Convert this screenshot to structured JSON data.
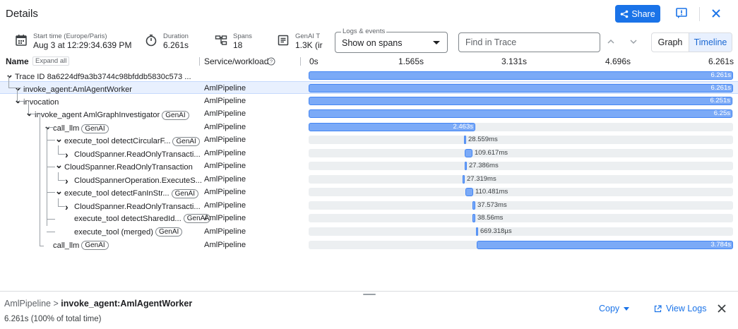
{
  "header": {
    "title": "Details",
    "share_label": "Share"
  },
  "summary": {
    "start_label": "Start time (Europe/Paris)",
    "start_value": "Aug 3 at 12:29:34.639 PM",
    "duration_label": "Duration",
    "duration_value": "6.261s",
    "spans_label": "Spans",
    "spans_value": "18",
    "genai_label": "GenAI T",
    "genai_value": "1.3K (ir",
    "logs_label": "Logs & events",
    "logs_value": "Show on spans",
    "find_placeholder": "Find in Trace",
    "view_graph": "Graph",
    "view_timeline": "Timeline"
  },
  "columns": {
    "name": "Name",
    "expand_all": "Expand all",
    "service": "Service/workload",
    "ticks": [
      "0s",
      "1.565s",
      "3.131s",
      "4.696s",
      "6.261s"
    ]
  },
  "total_duration_s": 6.261,
  "rows": [
    {
      "name": "Trace ID 8a6224df9a3b3744c98bfddb5830c573 ...",
      "chevron": "down",
      "chip": "",
      "service": "",
      "start_s": 0,
      "duration_s": 6.261,
      "label": "6.261s"
    },
    {
      "name": "invoke_agent:AmlAgentWorker",
      "chevron": "down",
      "chip": "",
      "service": "AmlPipeline",
      "start_s": 0,
      "duration_s": 6.261,
      "label": "6.261s"
    },
    {
      "name": "invocation",
      "chevron": "down",
      "chip": "",
      "service": "AmlPipeline",
      "start_s": 0,
      "duration_s": 6.251,
      "label": "6.251s"
    },
    {
      "name": "invoke_agent AmlGraphInvestigator",
      "chevron": "down",
      "chip": "GenAI",
      "service": "AmlPipeline",
      "start_s": 0,
      "duration_s": 6.25,
      "label": "6.25s"
    },
    {
      "name": "call_llm",
      "chevron": "down",
      "chip": "GenAI",
      "service": "AmlPipeline",
      "start_s": 0,
      "duration_s": 2.463,
      "label": "2.463s"
    },
    {
      "name": "execute_tool detectCircularF...",
      "chevron": "down",
      "chip": "GenAI",
      "service": "AmlPipeline",
      "start_s": 2.289,
      "duration_s": 0.028559,
      "label": "28.559ms"
    },
    {
      "name": "CloudSpanner.ReadOnlyTransacti...",
      "chevron": "right",
      "chip": "",
      "service": "AmlPipeline",
      "start_s": 2.3,
      "duration_s": 0.109617,
      "label": "109.617ms"
    },
    {
      "name": "CloudSpanner.ReadOnlyTransaction",
      "chevron": "down",
      "chip": "",
      "service": "AmlPipeline",
      "start_s": 2.3,
      "duration_s": 0.027386,
      "label": "27.386ms"
    },
    {
      "name": "CloudSpannerOperation.ExecuteS...",
      "chevron": "right",
      "chip": "",
      "service": "AmlPipeline",
      "start_s": 2.276,
      "duration_s": 0.027319,
      "label": "27.319ms"
    },
    {
      "name": "execute_tool detectFanInStr...",
      "chevron": "down",
      "chip": "GenAI",
      "service": "AmlPipeline",
      "start_s": 2.31,
      "duration_s": 0.110481,
      "label": "110.481ms"
    },
    {
      "name": "CloudSpanner.ReadOnlyTransacti...",
      "chevron": "right",
      "chip": "",
      "service": "AmlPipeline",
      "start_s": 2.42,
      "duration_s": 0.037573,
      "label": "37.573ms"
    },
    {
      "name": "execute_tool detectSharedId...",
      "chevron": "",
      "chip": "GenAI",
      "service": "AmlPipeline",
      "start_s": 2.42,
      "duration_s": 0.03856,
      "label": "38.56ms"
    },
    {
      "name": "execute_tool (merged)",
      "chevron": "",
      "chip": "GenAI",
      "service": "AmlPipeline",
      "start_s": 2.466,
      "duration_s": 0.000669318,
      "label": "669.318µs"
    },
    {
      "name": "call_llm",
      "chevron": "",
      "chip": "GenAI",
      "service": "AmlPipeline",
      "start_s": 2.477,
      "duration_s": 3.784,
      "label": "3.784s"
    }
  ],
  "selected_index": 1,
  "details": {
    "breadcrumb_service": "AmlPipeline",
    "breadcrumb_sep": " > ",
    "breadcrumb_span": "invoke_agent:AmlAgentWorker",
    "duration": "6.261s (100% of total time)",
    "copy_label": "Copy",
    "view_logs_label": "View Logs"
  },
  "colors": {
    "accent": "#1a73e8",
    "bar": "#7baaf7",
    "selected_row": "#e8f0fe"
  }
}
